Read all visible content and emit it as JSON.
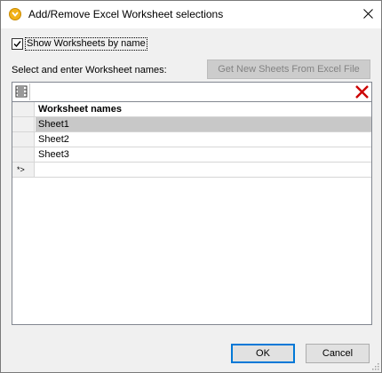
{
  "window": {
    "title": "Add/Remove Excel Worksheet selections",
    "icon": "mapforce-app-icon",
    "close_icon": "close-icon"
  },
  "options": {
    "show_by_name_label": "Show Worksheets by name",
    "show_by_name_checked": true
  },
  "select_label": "Select and enter Worksheet names:",
  "get_sheets_button": {
    "label": "Get New Sheets From Excel File",
    "enabled": false
  },
  "grid": {
    "toolbar": {
      "insert_icon": "insert-row-icon",
      "delete_icon": "delete-x-icon"
    },
    "column_header": "Worksheet names",
    "rows": [
      {
        "value": "Sheet1",
        "selected": true
      },
      {
        "value": "Sheet2",
        "selected": false
      },
      {
        "value": "Sheet3",
        "selected": false
      }
    ],
    "new_row_marker": "*>",
    "new_row_value": ""
  },
  "buttons": {
    "ok": "OK",
    "cancel": "Cancel"
  },
  "colors": {
    "selected_row": "#c8c8c8",
    "delete_icon": "#cc0000",
    "default_button_border": "#0078d7"
  }
}
